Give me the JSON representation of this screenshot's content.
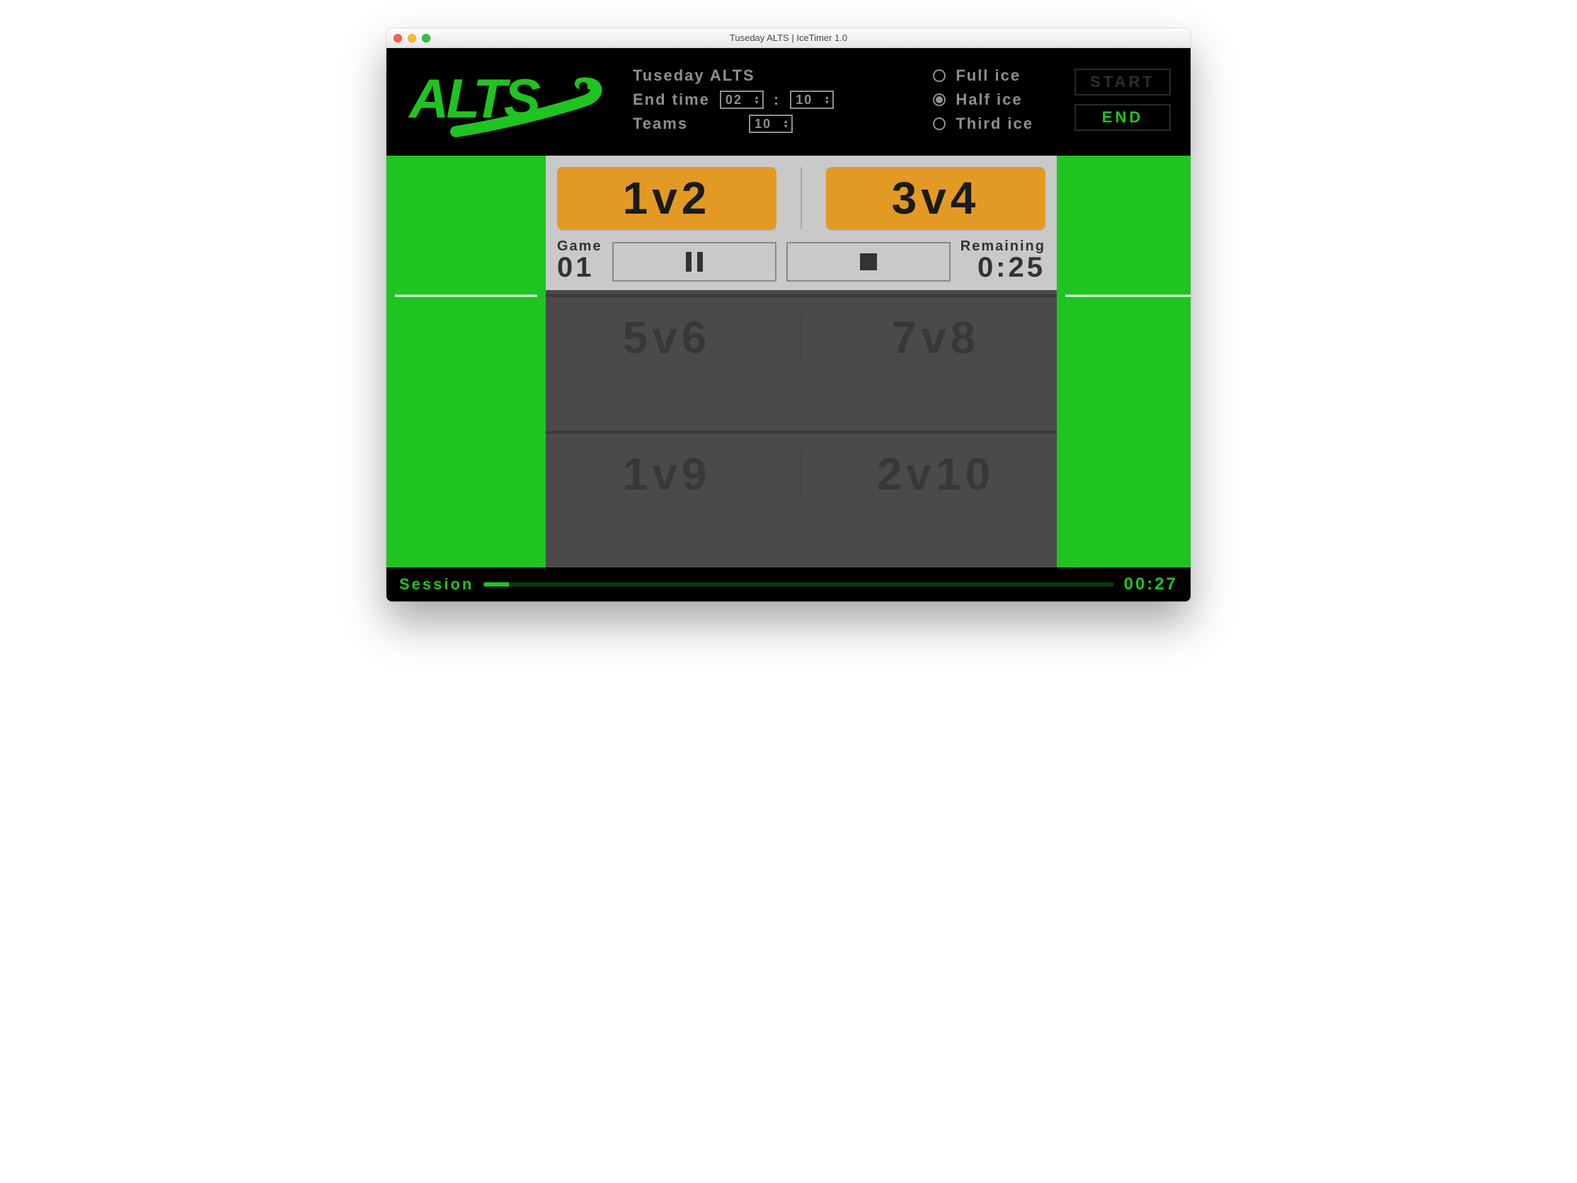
{
  "window": {
    "title": "Tuseday ALTS | IceTimer 1.0"
  },
  "header": {
    "logo_text": "ALTS",
    "session_name": "Tuseday ALTS",
    "end_time_label": "End time",
    "end_time_hours": "02",
    "end_time_minutes": "10",
    "teams_label": "Teams",
    "teams_value": "10"
  },
  "ice_options": {
    "options": [
      {
        "id": "full",
        "label": "Full ice",
        "selected": false
      },
      {
        "id": "half",
        "label": "Half ice",
        "selected": true
      },
      {
        "id": "third",
        "label": "Third ice",
        "selected": false
      }
    ]
  },
  "controls": {
    "start_label": "START",
    "end_label": "END"
  },
  "current_game": {
    "left_match": "1v2",
    "right_match": "3v4",
    "game_label": "Game",
    "game_number": "01",
    "remaining_label": "Remaining",
    "remaining_value": "0:25"
  },
  "queue": [
    {
      "left": "5v6",
      "right": "7v8"
    },
    {
      "left": "1v9",
      "right": "2v10"
    }
  ],
  "footer": {
    "label": "Session",
    "progress_percent": 4,
    "elapsed": "00:27"
  },
  "colors": {
    "green": "#1fc421",
    "orange": "#e29a25"
  }
}
